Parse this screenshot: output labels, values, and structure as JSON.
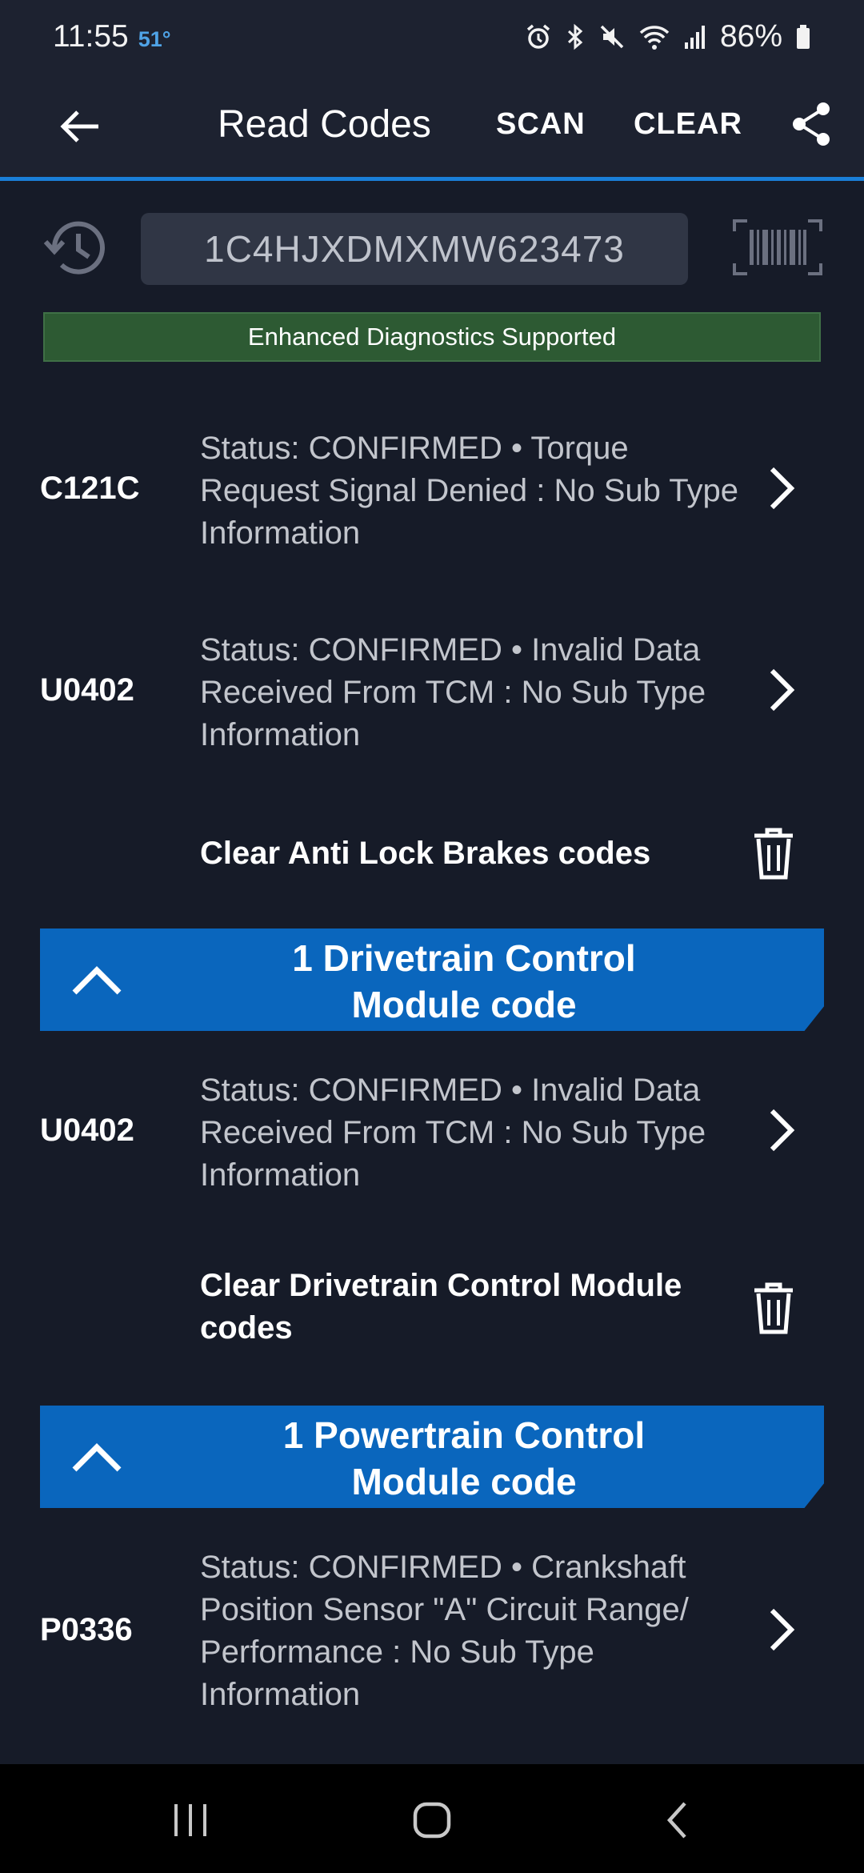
{
  "status_bar": {
    "time": "11:55",
    "temperature": "51°",
    "battery": "86%",
    "icons": [
      "alarm-icon",
      "bluetooth-icon",
      "mute-icon",
      "wifi-icon",
      "signal-icon",
      "battery-icon"
    ]
  },
  "app_bar": {
    "title": "Read Codes",
    "scan_label": "SCAN",
    "clear_label": "CLEAR"
  },
  "vin": {
    "value": "1C4HJXDMXMW623473"
  },
  "banner": {
    "text": "Enhanced Diagnostics Supported"
  },
  "codes": [
    {
      "code": "C121C",
      "description": "Status: CONFIRMED • Torque Request Signal Denied : No Sub Type Information"
    },
    {
      "code": "U0402",
      "description": "Status: CONFIRMED • Invalid Data Received From TCM : No Sub Type Information"
    }
  ],
  "clear_abs": {
    "label": "Clear Anti Lock Brakes codes"
  },
  "drivetrain": {
    "title_line1": "1 Drivetrain Control",
    "title_line2": "Module code",
    "codes": [
      {
        "code": "U0402",
        "description": "Status: CONFIRMED • Invalid Data Received From TCM : No Sub Type Information"
      }
    ],
    "clear_label_line1": "Clear Drivetrain Control Module",
    "clear_label_line2": "codes"
  },
  "powertrain": {
    "title_line1": "1 Powertrain Control",
    "title_line2": "Module code",
    "codes": [
      {
        "code": "P0336",
        "description": "Status: CONFIRMED • Crankshaft Position Sensor \"A\" Circuit Range/ Performance : No Sub Type Information"
      }
    ]
  },
  "colors": {
    "background": "#161b28",
    "app_bar": "#1d2230",
    "accent_blue": "#0a66bd",
    "banner_green": "#2d5a33"
  }
}
